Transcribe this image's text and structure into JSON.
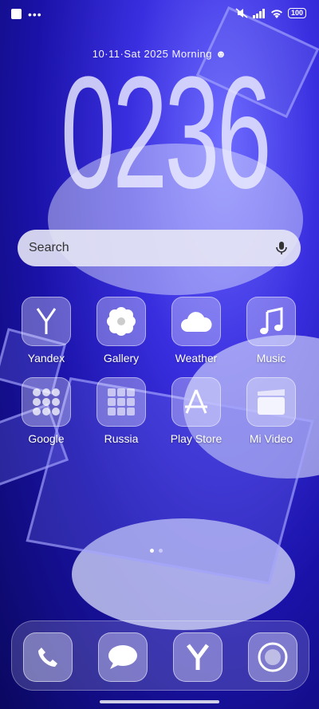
{
  "status": {
    "battery": "100"
  },
  "lockscreen": {
    "date": "10·11·Sat  2025  Morning ☻",
    "time": "0236"
  },
  "search": {
    "label": "Search"
  },
  "apps": [
    {
      "label": "Yandex",
      "icon": "yandex-y-icon"
    },
    {
      "label": "Gallery",
      "icon": "flower-icon"
    },
    {
      "label": "Weather",
      "icon": "cloud-icon"
    },
    {
      "label": "Music",
      "icon": "music-note-icon"
    },
    {
      "label": "Google",
      "icon": "folder-grid-icon"
    },
    {
      "label": "Russia",
      "icon": "folder-grid-icon"
    },
    {
      "label": "Play Store",
      "icon": "app-store-a-icon"
    },
    {
      "label": "Mi Video",
      "icon": "clapperboard-icon"
    }
  ],
  "dock": [
    {
      "icon": "phone-icon"
    },
    {
      "icon": "message-bubble-icon"
    },
    {
      "icon": "yandex-browser-icon"
    },
    {
      "icon": "camera-icon"
    }
  ],
  "colors": {
    "accent": "#3a2fe0",
    "glass": "#e6e6ff"
  }
}
